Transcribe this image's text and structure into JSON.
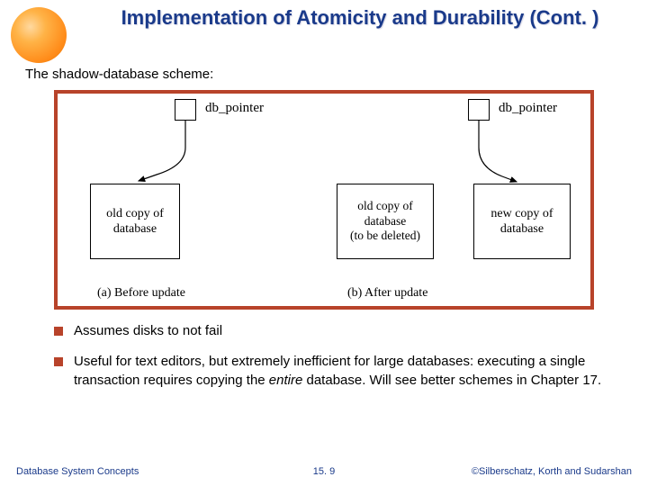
{
  "title": "Implementation of Atomicity and Durability (Cont. )",
  "intro": "The shadow-database scheme:",
  "diagram": {
    "left": {
      "ptr_label": "db_pointer",
      "box": "old copy of\ndatabase",
      "caption": "(a) Before update"
    },
    "right": {
      "ptr_label": "db_pointer",
      "box_old": "old copy of\ndatabase\n(to be deleted)",
      "box_new": "new copy of\ndatabase",
      "caption": "(b) After update"
    }
  },
  "bullets": {
    "b1": "Assumes disks to not fail",
    "b2_pre": "Useful for text editors, but extremely inefficient for large databases: executing a single transaction requires copying the ",
    "b2_em": "entire",
    "b2_post": " database.  Will see better schemes in Chapter 17."
  },
  "footer": {
    "left": "Database System Concepts",
    "center": "15. 9",
    "right": "©Silberschatz, Korth and Sudarshan"
  }
}
